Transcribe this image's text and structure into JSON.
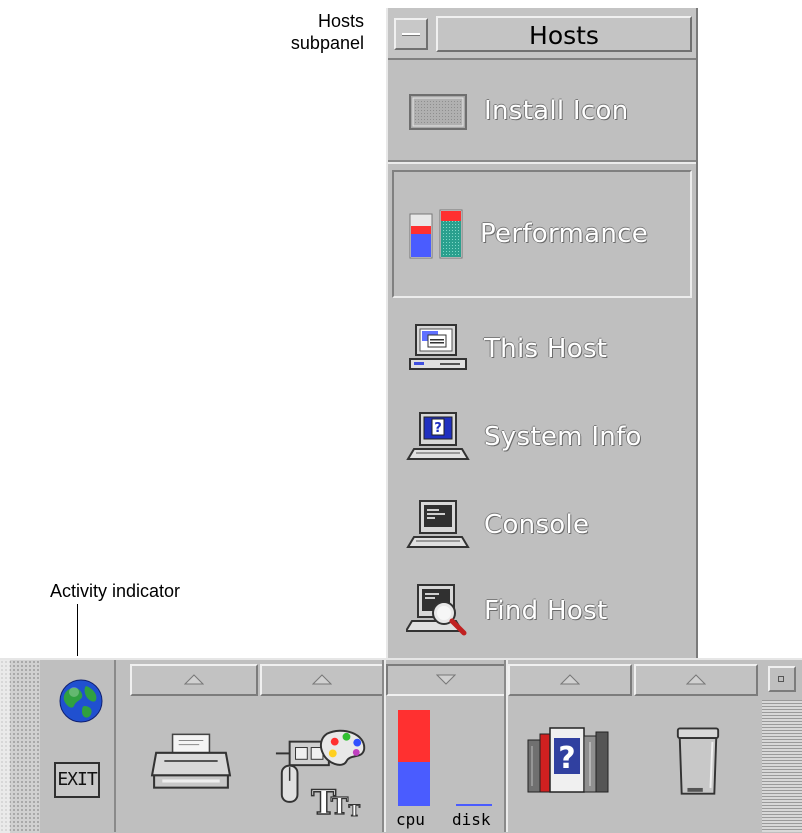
{
  "callouts": {
    "hosts_subpanel_line1": "Hosts",
    "hosts_subpanel_line2": "subpanel",
    "activity_indicator": "Activity indicator"
  },
  "subpanel": {
    "title": "Hosts",
    "items": [
      {
        "label": "Install Icon",
        "icon": "install-icon-drop-zone"
      },
      {
        "label": "Performance",
        "icon": "performance-meter-icon"
      },
      {
        "label": "This Host",
        "icon": "workstation-icon"
      },
      {
        "label": "System Info",
        "icon": "system-info-icon"
      },
      {
        "label": "Console",
        "icon": "console-terminal-icon"
      },
      {
        "label": "Find Host",
        "icon": "find-host-icon"
      }
    ]
  },
  "front_panel": {
    "exit_label": "EXIT",
    "activity_icon": "globe-icon",
    "slots": [
      {
        "name": "printer",
        "icon": "printer-icon",
        "arrow": "up"
      },
      {
        "name": "style-manager",
        "icon": "style-manager-icon",
        "arrow": "up"
      },
      {
        "name": "performance-meter",
        "icon": "cpu-disk-meter-icon",
        "arrow": "down",
        "cpu_label": "cpu",
        "disk_label": "disk"
      },
      {
        "name": "help",
        "icon": "help-books-icon",
        "arrow": "up"
      },
      {
        "name": "trash",
        "icon": "trash-can-icon",
        "arrow": "up"
      }
    ]
  },
  "colors": {
    "panel": "#bfbfbf",
    "meter_red": "#ff3030",
    "meter_blue": "#4a5cff",
    "meter_teal": "#2a9a8a",
    "globe_blue": "#2050d0",
    "globe_green": "#30a040"
  }
}
